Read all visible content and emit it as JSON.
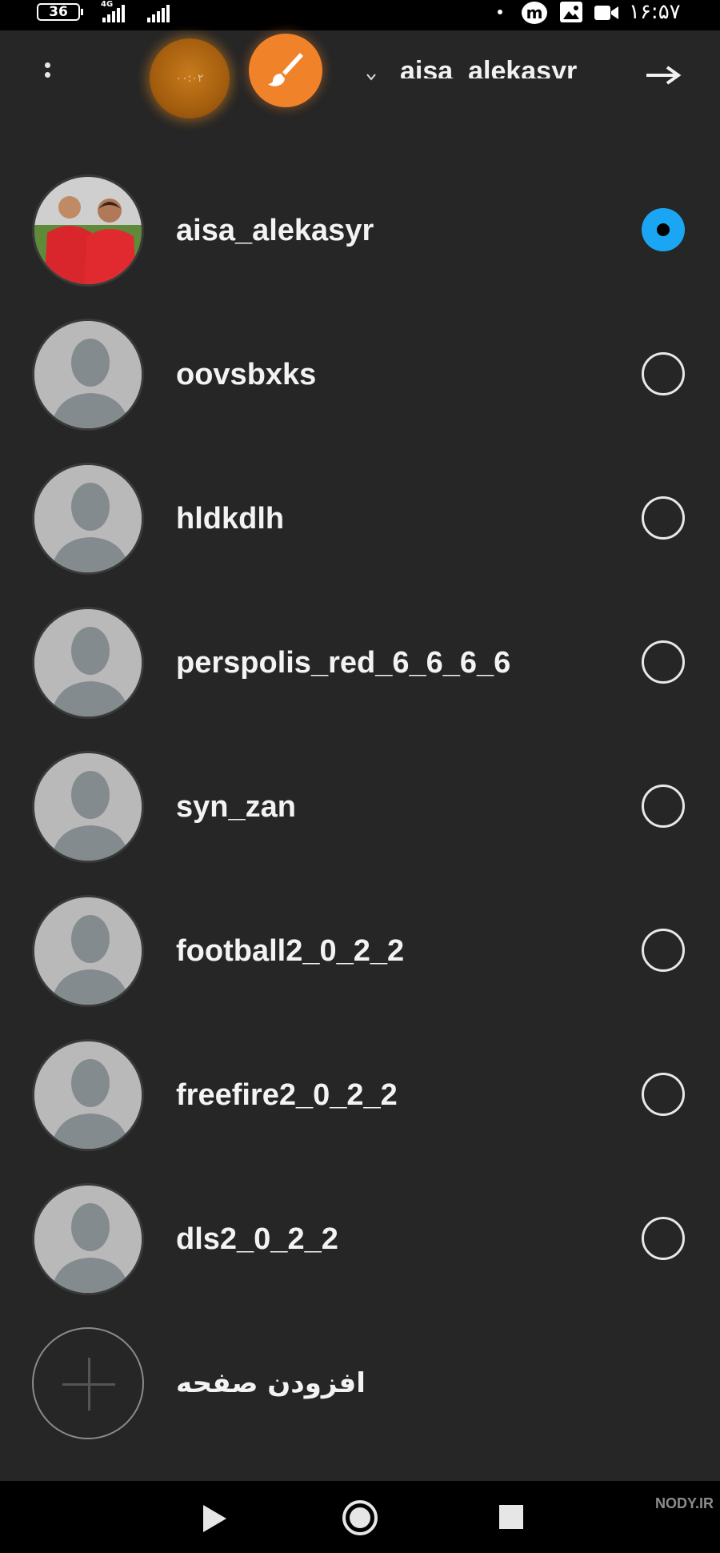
{
  "status_bar": {
    "battery": "36",
    "network_label": "4G",
    "time": "۱۶:۵۷"
  },
  "header": {
    "timer_text": "۰۰:۰۲",
    "current_account": "aisa_alekasyr"
  },
  "accounts": [
    {
      "username": "aisa_alekasyr",
      "selected": true
    },
    {
      "username": "oovsbxks",
      "selected": false
    },
    {
      "username": "hldkdlh",
      "selected": false
    },
    {
      "username": "perspolis_red_6_6_6_6",
      "selected": false
    },
    {
      "username": "syn_zan",
      "selected": false
    },
    {
      "username": "football2_0_2_2",
      "selected": false
    },
    {
      "username": "freefire2_0_2_2",
      "selected": false
    },
    {
      "username": "dls2_0_2_2",
      "selected": false
    }
  ],
  "add_page": {
    "label": "افزودن صفحه"
  },
  "watermark": {
    "text": "NODY.IR"
  },
  "colors": {
    "background": "#262626",
    "accent_selected": "#1aa6f2",
    "brush_bubble": "#f0822a",
    "timer_bubble": "#a45e0e"
  },
  "icons": {
    "menu": "vertical-dots-icon",
    "brush": "paintbrush-icon",
    "back": "arrow-right-icon",
    "nav_back": "triangle-back-icon",
    "nav_home": "circle-home-icon",
    "nav_recents": "square-recents-icon"
  }
}
